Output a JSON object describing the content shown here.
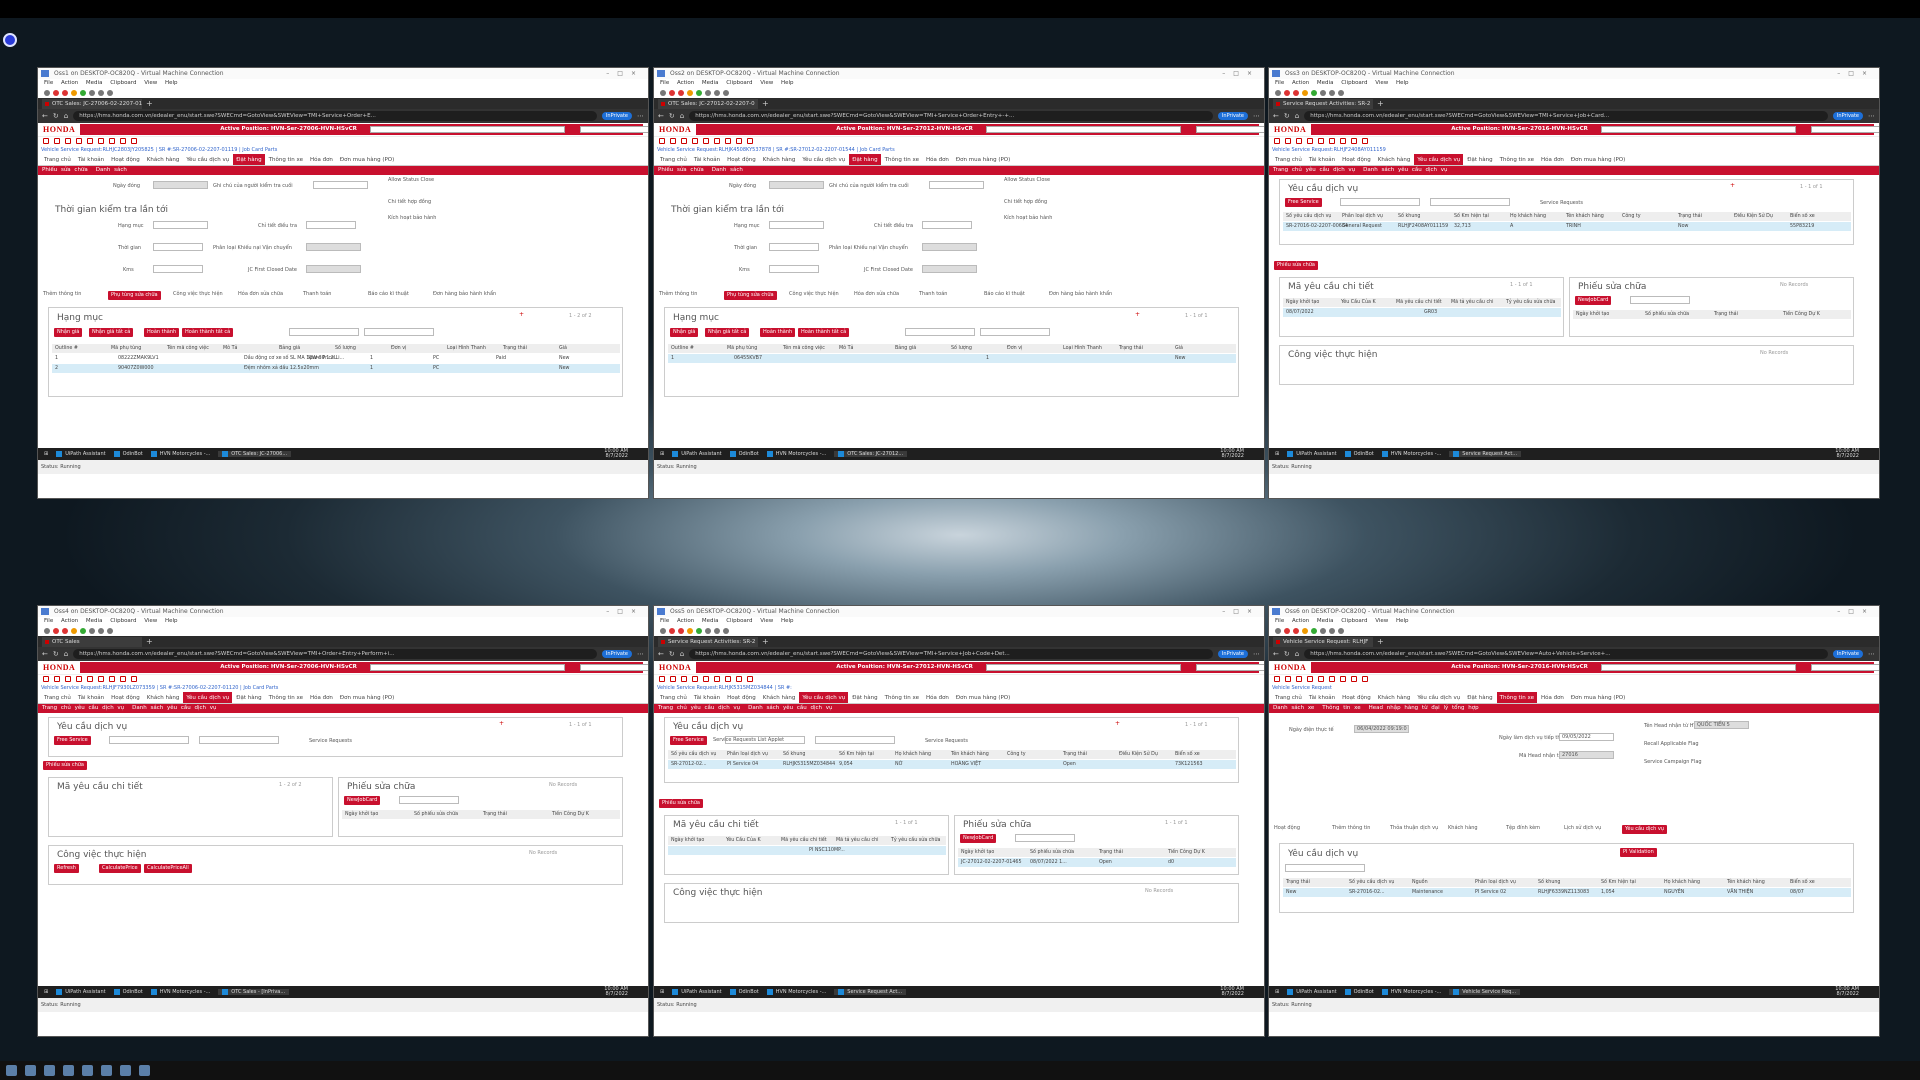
{
  "windows": [
    {
      "vm_title": "Oss1 on DESKTOP-OC820Q - Virtual Machine Connection",
      "tab": "OTC Sales: JC-27006-02-2207-01",
      "url": "https://hms.honda.com.vn/edealer_enu/start.swe?SWECmd=GotoView&SWEView=TMI+Service+Order+E...",
      "position": "Active Position: HVN-Ser-27006-HVN-HSvCR",
      "breadcrumb": "Vehicle Service Request:RLHJC2803JY205825 | SR #:SR-27006-02-2207-01119 | Job Card Parts",
      "tabs": [
        "Trang chủ",
        "Tài khoản",
        "Hoạt động",
        "Khách hàng",
        "Yêu cầu dịch vụ",
        "Đặt hàng",
        "Thông tin xe",
        "Hóa đơn",
        "Đơn mua hàng (PO)"
      ],
      "active_tab": "Đặt hàng",
      "sub": [
        "Phiếu sửa chữa",
        "Danh sách"
      ],
      "clock": [
        "10:00 AM",
        "8/7/2022"
      ]
    },
    {
      "vm_title": "Oss2 on DESKTOP-OC820Q - Virtual Machine Connection",
      "tab": "OTC Sales: JC-27012-02-2207-0",
      "url": "https://hms.honda.com.vn/edealer_enu/start.swe?SWECmd=GotoView&SWEView=TMI+Service+Order+Entry+-+...",
      "position": "Active Position: HVN-Ser-27012-HVN-HSvCR",
      "breadcrumb": "Vehicle Service Request:RLHJK4508KY537878 | SR #:SR-27012-02-2207-01544 | Job Card Parts",
      "tabs": [
        "Trang chủ",
        "Tài khoản",
        "Hoạt động",
        "Khách hàng",
        "Yêu cầu dịch vụ",
        "Đặt hàng",
        "Thông tin xe",
        "Hóa đơn",
        "Đơn mua hàng (PO)"
      ],
      "active_tab": "Đặt hàng",
      "sub": [
        "Phiếu sửa chữa",
        "Danh sách"
      ],
      "clock": [
        "10:00 AM",
        "8/7/2022"
      ]
    },
    {
      "vm_title": "Oss3 on DESKTOP-OC820Q - Virtual Machine Connection",
      "tab": "Service Request Activities: SR-2",
      "url": "https://hms.honda.com.vn/edealer_enu/start.swe?SWECmd=GotoView&SWEView=TMI+Service+Job+Card...",
      "position": "Active Position: HVN-Ser-27016-HVN-HSvCR",
      "breadcrumb": "Vehicle Service Request:RLHJF2408AY011159",
      "tabs": [
        "Trang chủ",
        "Tài khoản",
        "Hoạt động",
        "Khách hàng",
        "Yêu cầu dịch vụ",
        "Đặt hàng",
        "Thông tin xe",
        "Hóa đơn",
        "Đơn mua hàng (PO)"
      ],
      "active_tab": "Yêu cầu dịch vụ",
      "sub": [
        "Trang chủ yêu cầu dịch vụ",
        "Danh sách yêu cầu dịch vụ"
      ],
      "clock": [
        "10:00 AM",
        "8/7/2022"
      ]
    },
    {
      "vm_title": "Oss4 on DESKTOP-OC820Q - Virtual Machine Connection",
      "tab": "OTC Sales",
      "url": "https://hms.honda.com.vn/edealer_enu/start.swe?SWECmd=GotoView&SWEView=TMI+Order+Entry+Perform+i...",
      "position": "Active Position: HVN-Ser-27006-HVN-HSvCR",
      "breadcrumb": "Vehicle Service Request:RLHJF7930LZ073359 | SR #:SR-27006-02-2207-01120 | Job Card Parts",
      "tabs": [
        "Trang chủ",
        "Tài khoản",
        "Hoạt động",
        "Khách hàng",
        "Yêu cầu dịch vụ",
        "Đặt hàng",
        "Thông tin xe",
        "Hóa đơn",
        "Đơn mua hàng (PO)"
      ],
      "active_tab": "Yêu cầu dịch vụ",
      "sub": [
        "Trang chủ yêu cầu dịch vụ",
        "Danh sách yêu cầu dịch vụ"
      ],
      "clock": [
        "10:00 AM",
        "8/7/2022"
      ]
    },
    {
      "vm_title": "Oss5 on DESKTOP-OC820Q - Virtual Machine Connection",
      "tab": "Service Request Activities: SR-2",
      "url": "https://hms.honda.com.vn/edealer_enu/start.swe?SWECmd=GotoView&SWEView=TMI+Service+Job+Code+Det...",
      "position": "Active Position: HVN-Ser-27012-HVN-HSvCR",
      "breadcrumb": "Vehicle Service Request:RLHJK5315MZ034844 | SR #:",
      "tabs": [
        "Trang chủ",
        "Tài khoản",
        "Hoạt động",
        "Khách hàng",
        "Yêu cầu dịch vụ",
        "Đặt hàng",
        "Thông tin xe",
        "Hóa đơn",
        "Đơn mua hàng (PO)"
      ],
      "active_tab": "Yêu cầu dịch vụ",
      "sub": [
        "Trang chủ yêu cầu dịch vụ",
        "Danh sách yêu cầu dịch vụ"
      ],
      "clock": [
        "10:00 AM",
        "8/7/2022"
      ]
    },
    {
      "vm_title": "Oss6 on DESKTOP-OC820Q - Virtual Machine Connection",
      "tab": "Vehicle Service Request: RLHJF",
      "url": "https://hms.honda.com.vn/edealer_enu/start.swe?SWECmd=GotoView&SWEView=Auto+Vehicle+Service+...",
      "position": "Active Position: HVN-Ser-27016-HVN-HSvCR",
      "breadcrumb": "Vehicle Service Request",
      "tabs": [
        "Trang chủ",
        "Tài khoản",
        "Hoạt động",
        "Khách hàng",
        "Yêu cầu dịch vụ",
        "Đặt hàng",
        "Thông tin xe",
        "Hóa đơn",
        "Đơn mua hàng (PO)"
      ],
      "active_tab": "Thông tin xe",
      "sub": [
        "Danh sách xe",
        "Thông tin xe",
        "Head nhập hàng từ đại lý tổng hợp"
      ],
      "clock": [
        "10:00 AM",
        "8/7/2022"
      ]
    }
  ],
  "vm_menu": "File Action Media Clipboard View Help",
  "private": "InPrivate",
  "logo": "HONDA",
  "status": "Status: Running",
  "taskbar": [
    "UiPath Assistant",
    "OdinBot",
    "HVN Motorcycles -..."
  ],
  "taskbar_active": [
    "OTC Sales: JC-27006...",
    "OTC Sales: JC-27012...",
    "Service Request Act...",
    "OTC Sales - [InPriva...",
    "Service Request Act...",
    "Vehicle Service Req..."
  ],
  "jobcard": {
    "labels": {
      "date": "Ngày đóng",
      "inspector": "Ghi chú của người kiểm tra cuối",
      "check_time": "Thời gian kiểm tra lần tới",
      "item": "Hạng mục",
      "adjust": "Chỉ tiết điều tra",
      "time": "Thời gian",
      "ship": "Phân loại Khiếu nại Vận chuyển",
      "kms": "Kms",
      "first_closed": "JC First Closed Date",
      "allow": "Allow Status Close",
      "contract": "Chi tiết hợp đồng",
      "warranty": "Kích hoạt bảo hành"
    },
    "subtabs": [
      "Thêm thông tin",
      "Phụ tùng sửa chữa",
      "Công việc thực hiện",
      "Hóa đơn sửa chữa",
      "Thanh toán",
      "Báo cáo kĩ thuật",
      "Đơn hàng bảo hành khẩn"
    ],
    "section": "Hạng mục",
    "buttons": [
      "Nhận giá",
      "Nhận giá tất cả",
      "Hoàn thành",
      "Hoàn thành tất cả"
    ],
    "headers1": [
      "Outline #",
      "Mã phụ tùng",
      "Tên mã công việc",
      "Mô Tả",
      "Bảng giá",
      "Số lượng",
      "Đơn vị",
      "Loại Hình Thanh",
      "Trạng thái",
      "Giá"
    ],
    "w1_rows": [
      [
        "1",
        "08222ZMAK9LV1",
        "",
        "Dầu động cơ xe số SL MA 10W-30 1.2L",
        "Spare Price Li...",
        "1",
        "PC",
        "Paid",
        "New"
      ],
      [
        "2",
        "90407Z0W000",
        "",
        "Đệm nhôm xả dầu 12.5x20mm",
        "",
        "1",
        "PC",
        "",
        "New"
      ]
    ],
    "w1_pager": "1 - 2 of 2",
    "w2_rows": [
      [
        "1",
        "06455KVB7",
        "",
        "",
        "",
        "1",
        "",
        "",
        "New"
      ]
    ],
    "w2_pager": "1 - 1 of 1"
  },
  "sr": {
    "title": "Yêu cầu dịch vụ",
    "free": "Free Service",
    "query": "Service Requests",
    "headers": [
      "Số yêu cầu dịch vụ",
      "Phân loại dịch vụ",
      "Số khung",
      "Số Km hiện tại",
      "Họ khách hàng",
      "Tên khách hàng",
      "Công ty",
      "Trạng thái",
      "Điều Kiện Sử Dụ",
      "Biển số xe"
    ],
    "w3_row": [
      "SR-27016-02-2207-00634",
      "General Request",
      "RLHJF2408AY011159",
      "32,713",
      "A",
      "TRINH",
      "",
      "Now",
      "",
      "55P83219"
    ],
    "w5_row": [
      "SR-27012-02...",
      "PI Service 04",
      "RLHJK5315MZ034844",
      "9,054",
      "NỞ",
      "HOÀNG VIỆT",
      "",
      "Open",
      "",
      "73K121563"
    ],
    "w5_tooltip": "Service Requests List Applet",
    "repair": "Phiếu sửa chữa",
    "detail": "Mã yêu cầu chi tiết",
    "detail_headers": [
      "Ngày khởi tạo",
      "Yêu Cầu Của K",
      "Mã yêu cầu chi tiết",
      "Mã tả yêu cầu chi",
      "Tỷ yêu cầu sửa chữa"
    ],
    "w3_detail_row": [
      "08/07/2022",
      "",
      "GR03",
      ""
    ],
    "w5_detail_row": [
      "",
      "",
      "PI NSC110MP...",
      ""
    ],
    "pager1": "1 - 1 of 1",
    "no_records": "No Records",
    "newjob": "NewJobCard",
    "repair_headers": [
      "Ngày khởi tạo",
      "Số phiếu sửa chữa",
      "Trạng thái",
      "Tiền Công Dự K"
    ],
    "w5_repair_row": [
      "JC-27012-02-2207-01465",
      "08/07/2022 1...",
      "Open",
      "d0"
    ],
    "work": "Công việc thực hiện",
    "work_buttons": [
      "Refresh",
      "CalculatePrice",
      "CalculatePriceAll"
    ],
    "w4_pager2": "1 - 2 of 2"
  },
  "vehicle": {
    "labels": {
      "start": "Ngày điện thực tế",
      "start_val": "06/04/2022 09:19:0",
      "last_service": "Ngày làm dịch vụ tiếp theo",
      "last_val": "09/05/2022",
      "head_hvn": "Mã Head nhận từ HVN",
      "head_val": "27016",
      "head_name": "Tên Head nhận từ HVN",
      "head_name_val": "QUỐC TIẾN 5",
      "recall": "Recall Applicable Flag",
      "campaign": "Service Campaign Flag"
    },
    "subtabs": [
      "Hoạt động",
      "Thêm thông tin",
      "Thỏa thuận dịch vụ",
      "Khách hàng",
      "Tệp đính kèm",
      "Lịch sử dịch vụ",
      "Yêu cầu dịch vụ"
    ],
    "pi": "PI Validation",
    "headers": [
      "Trạng thái",
      "Số yêu cầu dịch vụ",
      "Nguồn",
      "Phân loại dịch vụ",
      "Số khung",
      "Số Km hiện tại",
      "Họ khách hàng",
      "Tên khách hàng",
      "Biển số xe"
    ],
    "row": [
      "New",
      "SR-27016-02...",
      "Maintenance",
      "PI Service 02",
      "RLHJF6339NZ113083",
      "1,054",
      "NGUYỄN",
      "VĂN THIỆN",
      "08/07"
    ]
  }
}
